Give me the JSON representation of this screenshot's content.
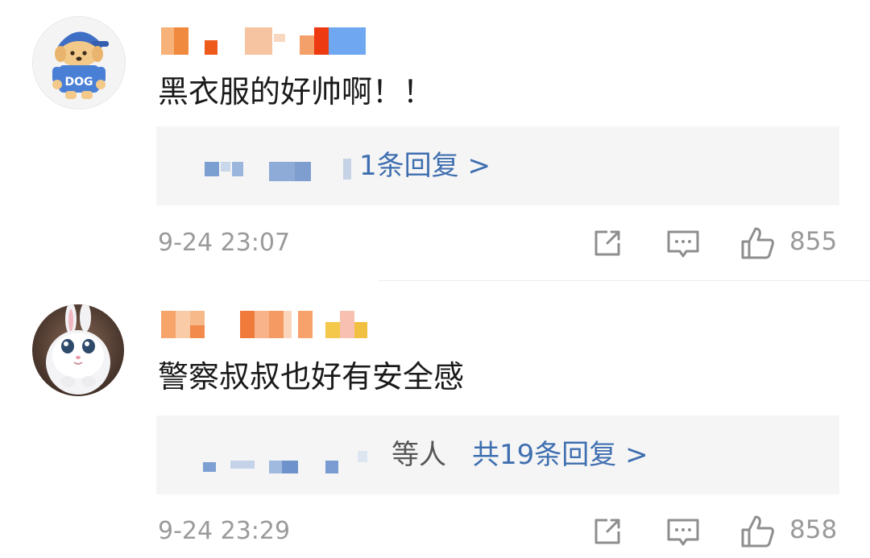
{
  "comments": [
    {
      "text": "黑衣服的好帅啊！！",
      "reply_prefix": "",
      "reply_link": "1条回复 >",
      "timestamp": "9-24 23:07",
      "likes": "855",
      "avatar_label": "DOG"
    },
    {
      "text": "警察叔叔也好有安全感",
      "reply_prefix": "等人",
      "reply_link": "共19条回复 >",
      "timestamp": "9-24 23:29",
      "likes": "858"
    }
  ],
  "colors": {
    "reply_link": "#3f6fb0",
    "meta": "#9a9a9a",
    "reply_bg": "#f5f5f5"
  },
  "icons": [
    "share-icon",
    "comment-icon",
    "like-icon"
  ]
}
